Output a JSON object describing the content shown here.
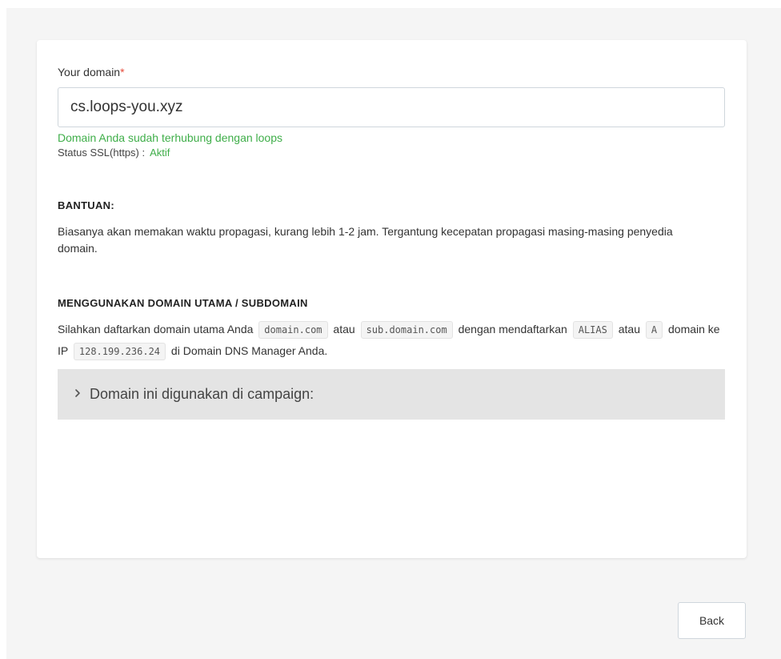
{
  "form": {
    "domain_label": "Your domain",
    "required_mark": "*",
    "domain_value": "cs.loops-you.xyz",
    "status_message": "Domain Anda sudah terhubung dengan loops",
    "ssl_label": "Status SSL(https) :",
    "ssl_value": "Aktif"
  },
  "help": {
    "title": "BANTUAN:",
    "text": "Biasanya akan memakan waktu propagasi, kurang lebih 1-2 jam. Tergantung kecepatan propagasi masing-masing penyedia domain."
  },
  "subdomain": {
    "title": "MENGGUNAKAN DOMAIN UTAMA / SUBDOMAIN",
    "t1": "Silahkan daftarkan domain utama Anda",
    "code1": "domain.com",
    "t2": "atau",
    "code2": "sub.domain.com",
    "t3": "dengan mendaftarkan",
    "code3": "ALIAS",
    "t4": "atau",
    "code4": "A",
    "t5": "domain ke IP",
    "code5": "128.199.236.24",
    "t6": "di Domain DNS Manager Anda."
  },
  "accordion": {
    "icon": "chevron-right-icon",
    "label": "Domain ini digunakan di campaign:"
  },
  "footer": {
    "back_label": "Back"
  },
  "colors": {
    "success": "#3fae49",
    "required": "#e74c3c",
    "accordion_bg": "#e4e4e4",
    "page_bg": "#f5f5f5"
  }
}
